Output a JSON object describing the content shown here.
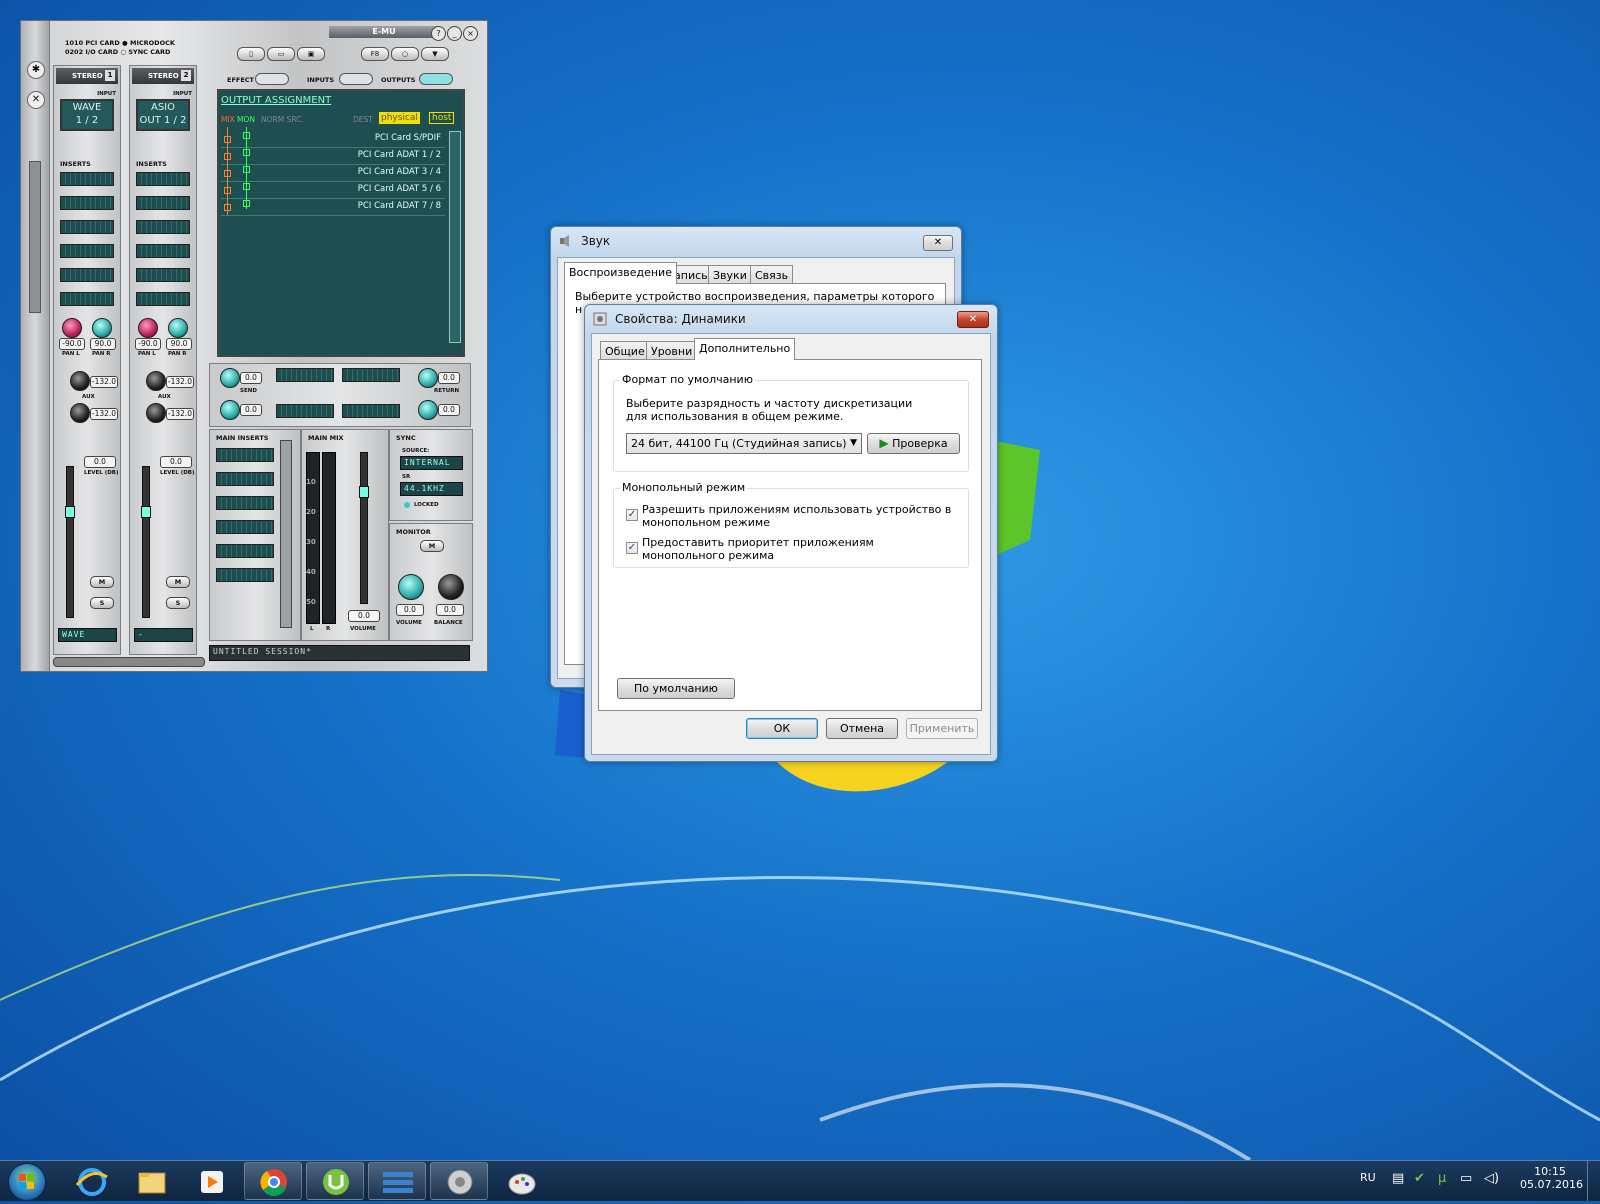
{
  "emu_mixer": {
    "card_info": [
      "1010 PCI CARD",
      "0202 I/O CARD",
      "MICRODOCK",
      "SYNC CARD"
    ],
    "brand": "E-MU",
    "tool_buttons": [
      "F8"
    ],
    "section_labels": {
      "effect": "EFFECT",
      "inputs": "INPUTS",
      "outputs": "OUTPUTS"
    },
    "strips": [
      {
        "name": "STEREO",
        "number": "1",
        "input_label": "INPUT",
        "input_value": "WAVE\n1 / 2",
        "inserts": "INSERTS",
        "pan_l": "-90.0",
        "pan_r": "90.0",
        "aux1": "-132.0",
        "aux2": "-132.0",
        "aux_label": "AUX",
        "level": "0.0",
        "level_label": "LEVEL (DB)",
        "m": "M",
        "s": "S",
        "display": "WAVE"
      },
      {
        "name": "STEREO",
        "number": "2",
        "input_label": "INPUT",
        "input_value": "ASIO\nOUT 1 / 2",
        "inserts": "INSERTS",
        "pan_l": "-90.0",
        "pan_r": "90.0",
        "aux1": "-132.0",
        "aux2": "-132.0",
        "aux_label": "AUX",
        "level": "0.0",
        "level_label": "LEVEL (DB)",
        "m": "M",
        "s": "S",
        "display": "-"
      }
    ],
    "pan_labels": {
      "l": "PAN L",
      "r": "PAN R"
    },
    "output_assignment": {
      "title": "OUTPUT ASSIGNMENT",
      "mix": "MIX",
      "mon": "MON",
      "norm_src": "NORM SRC.",
      "dest": "DEST",
      "physical": "physical",
      "host": "host",
      "rows": [
        "PCI Card S/PDIF",
        "PCI Card ADAT 1 / 2",
        "PCI Card ADAT 3 / 4",
        "PCI Card ADAT 5 / 6",
        "PCI Card ADAT 7 / 8"
      ]
    },
    "send": {
      "label": "SEND",
      "v1": "0.0",
      "v2": "0.0"
    },
    "return": {
      "label": "RETURN",
      "v1": "0.0",
      "v2": "0.0"
    },
    "main_inserts": "MAIN INSERTS",
    "main_mix": {
      "label": "MAIN MIX",
      "scale": [
        "10",
        "20",
        "30",
        "40",
        "50"
      ],
      "l": "L",
      "r": "R",
      "volume": "0.0",
      "volume_label": "VOLUME"
    },
    "sync": {
      "label": "SYNC",
      "source_label": "SOURCE:",
      "source": "INTERNAL",
      "sr_label": "SR",
      "sr": "44.1KHZ",
      "locked": "LOCKED"
    },
    "monitor": {
      "label": "MONITOR",
      "m": "M",
      "volume": "0.0",
      "balance": "0.0",
      "volume_label": "VOLUME",
      "balance_label": "BALANCE"
    },
    "session": "UNTITLED SESSION*"
  },
  "sound_dialog": {
    "title": "Звук",
    "tabs": [
      "Воспроизведение",
      "Запись",
      "Звуки",
      "Связь"
    ],
    "active_tab": 0,
    "instruction": "Выберите устройство воспроизведения, параметры которого н"
  },
  "properties_dialog": {
    "title": "Свойства: Динамики",
    "tabs": [
      "Общие",
      "Уровни",
      "Дополнительно"
    ],
    "active_tab": 2,
    "default_format": {
      "group_label": "Формат по умолчанию",
      "description": "Выберите разрядность и частоту дискретизации для использования в общем режиме.",
      "selected": "24 бит, 44100 Гц (Студийная запись)",
      "test_button": "Проверка"
    },
    "exclusive": {
      "group_label": "Монопольный режим",
      "option1": "Разрешить приложениям использовать устройство в монопольном режиме",
      "option1_checked": true,
      "option2": "Предоставить приоритет приложениям монопольного режима",
      "option2_checked": true
    },
    "defaults_button": "По умолчанию",
    "ok": "ОК",
    "cancel": "Отмена",
    "apply": "Применить"
  },
  "taskbar": {
    "pinned": [
      "start-orb",
      "internet-explorer",
      "file-explorer",
      "media-player",
      "chrome",
      "utorrent",
      "emu-patchmix",
      "sound-speaker",
      "paint"
    ],
    "language": "RU",
    "time": "10:15",
    "date": "05.07.2016"
  },
  "colors": {
    "accent": "#1672c9",
    "emu_lcd": "#23595a",
    "physical_tag": "#f2e000",
    "mix_orange": "#ff7f2a",
    "mon_green": "#39ff5c"
  }
}
